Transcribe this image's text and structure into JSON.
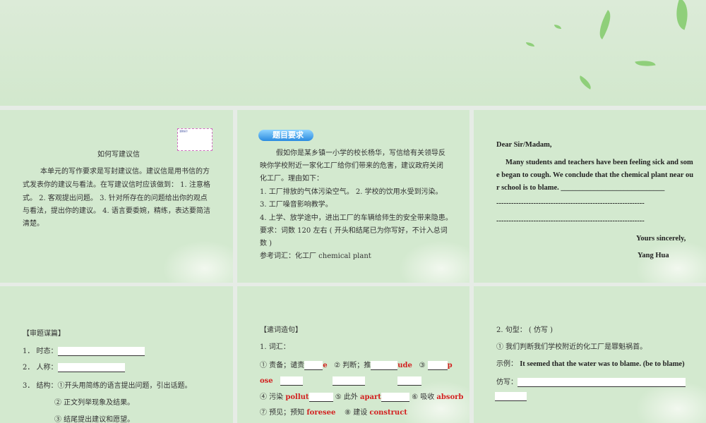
{
  "panel1": {
    "note": "温馨提示",
    "title": "如何写建议信",
    "lines": [
      "本单元的写作要求是写封建议信。建议信是用书信的方",
      "式发表你的建议与看法。在写建议信时应该做到： 1. 注意格",
      "式。 2. 客观提出问题。 3. 针对所存在的问题给出你的观点",
      "与看法，提出你的建议。 4. 语言要委婉，精练，表达要简洁",
      "清楚。"
    ]
  },
  "panel2": {
    "badge": "题目要求",
    "lines": [
      "假如你是某乡镇一小学的校长杨华，写信给有关领导反",
      "映你学校附近一家化工厂给你们带来的危害，建议政府关闭",
      "化工厂。理由如下：",
      "1. 工厂排放的气体污染空气。 2. 学校的饮用水受到污染。",
      "3. 工厂噪音影响教学。",
      "4. 上学、放学途中，进出工厂的车辆给师生的安全带来隐患。",
      "要求：词数 120 左右 ( 开头和结尾已为你写好，不计入总词",
      "数 )",
      "参考词汇：化工厂 chemical plant"
    ]
  },
  "panel3": {
    "greeting": "Dear Sir/Madam,",
    "lines": [
      "Many students and teachers have been feeling sick and som",
      "e began to cough. We conclude that the chemical plant near ou",
      "r school is to blame. ____________________________"
    ],
    "dash": "------------------------------------------------------------",
    "closing": "Yours sincerely,",
    "name": "Yang Hua"
  },
  "panel4": {
    "heading": "【审题谋篇】",
    "item1": "1． 时态：",
    "item2": "2． 人称：",
    "item3": "3． 结构：①开头用简练的语言提出问题，引出话题。",
    "sub2": "② 正文列举现象及结果。",
    "sub3": "③ 结尾提出建议和愿望。"
  },
  "panel5": {
    "heading": "【遣词造句】",
    "vocab": "1. 词汇：",
    "r1a": "① 责备；谴责",
    "r1a_e": "e",
    "r1b": "② 判断；推",
    "r1b_e": "ude",
    "r1c": "③ ",
    "r1c_e": "p",
    "r2": "ose",
    "r3a": "④ 污染 ",
    "r3a_e": "pollut",
    "r3b": "⑤ 此外 ",
    "r3b_e": "apart",
    "r3c": "⑥ 吸收 ",
    "r3c_e": "absorb",
    "r4a": "⑦ 预见；预知 ",
    "r4a_e": "foresee",
    "r4b": "⑧ 建设 ",
    "r4b_e": "construct"
  },
  "panel6": {
    "heading": "2. 句型： ( 仿写 )",
    "item": "① 我们判断我们学校附近的化工厂是罪魁祸首。",
    "example_label": "示例： ",
    "example_pre": "It seemed that the water ",
    "example_hl": "was to blame",
    "example_post": ". (be to blame)",
    "imitate": "仿写："
  }
}
